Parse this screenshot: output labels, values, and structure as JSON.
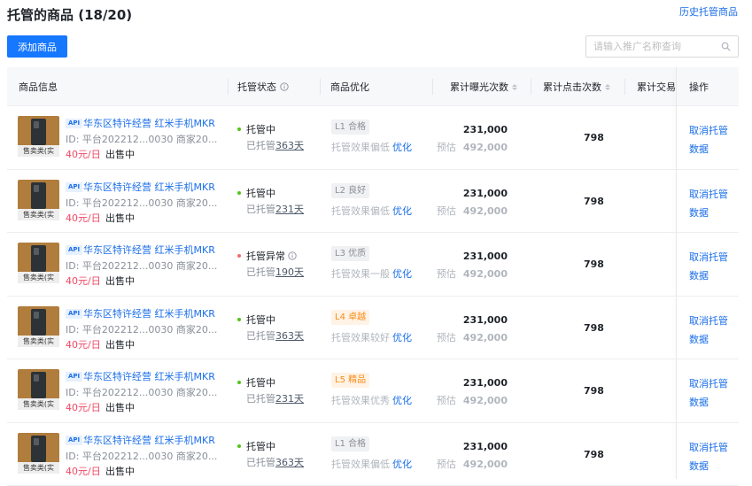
{
  "header": {
    "title": "托管的商品 (18/20)",
    "history_link": "历史托管商品"
  },
  "toolbar": {
    "add_label": "添加商品",
    "search_placeholder": "请输入推广名称查询"
  },
  "table": {
    "columns": [
      "商品信息",
      "托管状态",
      "商品优化",
      "累计曝光次数",
      "累计点击次数",
      "累计交易",
      "操作"
    ],
    "rows": [
      {
        "tag": "售卖类(实",
        "api": "API",
        "name": "华东区特许经营 红米手机MKR",
        "id": "ID: 平台202212...0030 商家20...",
        "price": "40元/日",
        "sale": "出售中",
        "status": "托管中",
        "status_type": "ok",
        "days_prefix": "已托管",
        "days": "363天",
        "level": "L1 合格",
        "level_style": "gray",
        "opt_text": "托管效果偏低",
        "opt_link": "优化",
        "exposure": "231,000",
        "est_label": "预估",
        "est_value": "492,000",
        "clicks": "798",
        "op_label": "取消托管数据"
      },
      {
        "tag": "售卖类(实",
        "api": "API",
        "name": "华东区特许经营 红米手机MKR",
        "id": "ID: 平台202212...0030 商家20...",
        "price": "40元/日",
        "sale": "出售中",
        "status": "托管中",
        "status_type": "ok",
        "days_prefix": "已托管",
        "days": "231天",
        "level": "L2 良好",
        "level_style": "gray",
        "opt_text": "托管效果偏低",
        "opt_link": "优化",
        "exposure": "231,000",
        "est_label": "预估",
        "est_value": "492,000",
        "clicks": "798",
        "op_label": "取消托管数据"
      },
      {
        "tag": "售卖类(实",
        "api": "API",
        "name": "华东区特许经营 红米手机MKR",
        "id": "ID: 平台202212...0030 商家20...",
        "price": "40元/日",
        "sale": "出售中",
        "status": "托管异常",
        "status_type": "err",
        "days_prefix": "已托管",
        "days": "190天",
        "level": "L3 优质",
        "level_style": "gray",
        "opt_text": "托管效果一般",
        "opt_link": "优化",
        "exposure": "231,000",
        "est_label": "预估",
        "est_value": "492,000",
        "clicks": "798",
        "op_label": "取消托管数据"
      },
      {
        "tag": "售卖类(实",
        "api": "API",
        "name": "华东区特许经营 红米手机MKR",
        "id": "ID: 平台202212...0030 商家20...",
        "price": "40元/日",
        "sale": "出售中",
        "status": "托管中",
        "status_type": "ok",
        "days_prefix": "已托管",
        "days": "363天",
        "level": "L4 卓越",
        "level_style": "orange",
        "opt_text": "托管效果较好",
        "opt_link": "优化",
        "exposure": "231,000",
        "est_label": "预估",
        "est_value": "492,000",
        "clicks": "798",
        "op_label": "取消托管数据"
      },
      {
        "tag": "售卖类(实",
        "api": "API",
        "name": "华东区特许经营 红米手机MKR",
        "id": "ID: 平台202212...0030 商家20...",
        "price": "40元/日",
        "sale": "出售中",
        "status": "托管中",
        "status_type": "ok",
        "days_prefix": "已托管",
        "days": "231天",
        "level": "L5 精品",
        "level_style": "orange",
        "opt_text": "托管效果优秀",
        "opt_link": "优化",
        "exposure": "231,000",
        "est_label": "预估",
        "est_value": "492,000",
        "clicks": "798",
        "op_label": "取消托管数据"
      },
      {
        "tag": "售卖类(实",
        "api": "API",
        "name": "华东区特许经营 红米手机MKR",
        "id": "ID: 平台202212...0030 商家20...",
        "price": "40元/日",
        "sale": "出售中",
        "status": "托管中",
        "status_type": "ok",
        "days_prefix": "已托管",
        "days": "363天",
        "level": "L1 合格",
        "level_style": "gray",
        "opt_text": "托管效果偏低",
        "opt_link": "优化",
        "exposure": "231,000",
        "est_label": "预估",
        "est_value": "492,000",
        "clicks": "798",
        "op_label": "取消托管数据"
      }
    ]
  },
  "colors": {
    "primary": "#1677ff",
    "link": "#1a6ee8",
    "price": "#f04864",
    "ok": "#52c41a",
    "err": "#f56c6c",
    "level_orange": "#fa8c16"
  }
}
